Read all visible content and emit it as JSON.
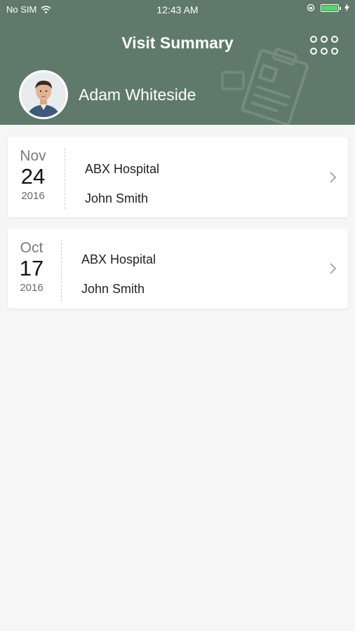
{
  "status_bar": {
    "carrier": "No SIM",
    "time": "12:43 AM",
    "battery_level": 1.0,
    "battery_color": "#4cd964"
  },
  "header": {
    "title": "Visit Summary",
    "background_color": "#5f7a6b",
    "menu_icon": "grid-dots-icon"
  },
  "user": {
    "name": "Adam Whiteside",
    "avatar_icon": "user-avatar-photo"
  },
  "visits": [
    {
      "month": "Nov",
      "day": "24",
      "year": "2016",
      "hospital": "ABX Hospital",
      "doctor": "John Smith"
    },
    {
      "month": "Oct",
      "day": "17",
      "year": "2016",
      "hospital": "ABX Hospital",
      "doctor": "John Smith"
    }
  ]
}
